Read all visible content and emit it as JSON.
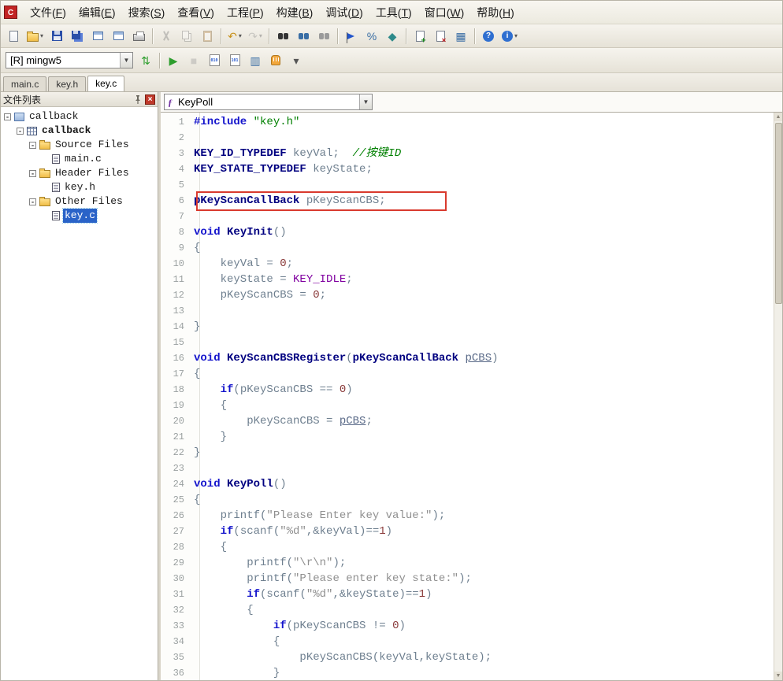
{
  "app": {
    "icon_label": "C"
  },
  "menu_bar": {
    "items": [
      {
        "key": "file",
        "label": "文件(F)"
      },
      {
        "key": "edit",
        "label": "编辑(E)"
      },
      {
        "key": "search",
        "label": "搜索(S)"
      },
      {
        "key": "view",
        "label": "查看(V)"
      },
      {
        "key": "project",
        "label": "工程(P)"
      },
      {
        "key": "build",
        "label": "构建(B)"
      },
      {
        "key": "debug",
        "label": "调试(D)"
      },
      {
        "key": "tools",
        "label": "工具(T)"
      },
      {
        "key": "window",
        "label": "窗口(W)"
      },
      {
        "key": "help",
        "label": "帮助(H)"
      }
    ]
  },
  "toolbar_main": {
    "icons": [
      {
        "name": "new-file",
        "kind": "page"
      },
      {
        "name": "open-file",
        "kind": "folder",
        "dropdown": true
      },
      {
        "name": "save",
        "kind": "floppy"
      },
      {
        "name": "save-all",
        "kind": "floppy2"
      },
      {
        "name": "close-window",
        "kind": "win"
      },
      {
        "name": "close-all-windows",
        "kind": "win"
      },
      {
        "name": "print",
        "kind": "printer"
      },
      {
        "sep": true
      },
      {
        "name": "cut",
        "kind": "cut",
        "disabled": true
      },
      {
        "name": "copy",
        "kind": "pages",
        "disabled": true
      },
      {
        "name": "paste",
        "kind": "clipboard",
        "disabled": true
      },
      {
        "sep": true
      },
      {
        "name": "undo",
        "kind": "glyph",
        "glyph": "↶",
        "color": "#c8921e",
        "dropdown": true
      },
      {
        "name": "redo",
        "kind": "glyph",
        "glyph": "↷",
        "color": "#8a8a8a",
        "disabled": true,
        "dropdown": true
      },
      {
        "sep": true
      },
      {
        "name": "find",
        "kind": "binoc-dark"
      },
      {
        "name": "find-in-files",
        "kind": "binoc-blue"
      },
      {
        "name": "find-replace",
        "kind": "binoc-dim"
      },
      {
        "sep": true
      },
      {
        "name": "toggle-bookmark",
        "kind": "flag"
      },
      {
        "name": "comment",
        "kind": "glyph",
        "glyph": "%",
        "color": "#3a6ea5"
      },
      {
        "name": "goto-line",
        "kind": "glyph",
        "glyph": "◆",
        "color": "#2d8a8a"
      },
      {
        "sep": true
      },
      {
        "name": "add-file",
        "kind": "page-plus"
      },
      {
        "name": "remove-file",
        "kind": "page-x"
      },
      {
        "name": "export",
        "kind": "glyph",
        "glyph": "▦",
        "color": "#3a6ea5"
      },
      {
        "sep": true
      },
      {
        "name": "help",
        "kind": "round",
        "glyph": "?"
      },
      {
        "name": "about",
        "kind": "round",
        "glyph": "i",
        "dropdown": true
      }
    ]
  },
  "toolbar_build": {
    "config_value": "[R] mingw5",
    "icons": [
      {
        "name": "switch-build-target",
        "kind": "glyph",
        "glyph": "⇅",
        "color": "#2e9e2e"
      },
      {
        "sep": true
      },
      {
        "name": "run",
        "kind": "glyph",
        "glyph": "▶",
        "color": "#2e9e2e"
      },
      {
        "name": "stop",
        "kind": "glyph",
        "glyph": "■",
        "color": "#9a9a9a",
        "disabled": true
      },
      {
        "name": "step-over",
        "kind": "step",
        "glyph": "010"
      },
      {
        "name": "step-into",
        "kind": "step",
        "glyph": "101"
      },
      {
        "name": "build-file",
        "kind": "glyph",
        "glyph": "▥",
        "color": "#3a6ea5"
      },
      {
        "name": "pause",
        "kind": "hand"
      },
      {
        "name": "more-build-actions",
        "kind": "glyph",
        "glyph": "▾",
        "color": "#555555"
      }
    ]
  },
  "doc_tabs": {
    "active": "key.c",
    "items": [
      "main.c",
      "key.h",
      "key.c"
    ]
  },
  "sidebar": {
    "title": "文件列表",
    "tree": [
      {
        "depth": 0,
        "label": "callback",
        "icon": "workspace",
        "expand": true
      },
      {
        "depth": 1,
        "label": "callback",
        "icon": "project",
        "expand": true,
        "bold": true
      },
      {
        "depth": 2,
        "label": "Source Files",
        "icon": "folder",
        "expand": true
      },
      {
        "depth": 3,
        "label": "main.c",
        "icon": "doc"
      },
      {
        "depth": 2,
        "label": "Header Files",
        "icon": "folder",
        "expand": true
      },
      {
        "depth": 3,
        "label": "key.h",
        "icon": "doc"
      },
      {
        "depth": 2,
        "label": "Other Files",
        "icon": "folder",
        "expand": true
      },
      {
        "depth": 3,
        "label": "key.c",
        "icon": "doc",
        "selected": true
      }
    ]
  },
  "editor": {
    "function_selector": "KeyPoll",
    "highlight_line": 6,
    "lines": [
      [
        [
          "k",
          "#include"
        ],
        [
          "p",
          " "
        ],
        [
          "g",
          "\"key.h\""
        ]
      ],
      [],
      [
        [
          "t",
          "KEY_ID_TYPEDEF"
        ],
        [
          "p",
          " keyVal;  "
        ],
        [
          "c",
          "//按键ID"
        ]
      ],
      [
        [
          "t",
          "KEY_STATE_TYPEDEF"
        ],
        [
          "p",
          " keyState;"
        ]
      ],
      [],
      [
        [
          "t",
          "pKeyScanCallBack"
        ],
        [
          "p",
          " pKeyScanCBS;"
        ]
      ],
      [],
      [
        [
          "k",
          "void"
        ],
        [
          "p",
          " "
        ],
        [
          "t",
          "KeyInit"
        ],
        [
          "p",
          "()"
        ]
      ],
      [
        [
          "p",
          "{"
        ]
      ],
      [
        [
          "p",
          "    keyVal = "
        ],
        [
          "n",
          "0"
        ],
        [
          "p",
          ";"
        ]
      ],
      [
        [
          "p",
          "    keyState = "
        ],
        [
          "m",
          "KEY_IDLE"
        ],
        [
          "p",
          ";"
        ]
      ],
      [
        [
          "p",
          "    pKeyScanCBS = "
        ],
        [
          "n",
          "0"
        ],
        [
          "p",
          ";"
        ]
      ],
      [],
      [
        [
          "p",
          "}"
        ]
      ],
      [],
      [
        [
          "k",
          "void"
        ],
        [
          "p",
          " "
        ],
        [
          "t",
          "KeyScanCBSRegister"
        ],
        [
          "p",
          "("
        ],
        [
          "t",
          "pKeyScanCallBack"
        ],
        [
          "p",
          " "
        ],
        [
          "u",
          "pCBS"
        ],
        [
          "p",
          ")"
        ]
      ],
      [
        [
          "p",
          "{"
        ]
      ],
      [
        [
          "p",
          "    "
        ],
        [
          "k",
          "if"
        ],
        [
          "p",
          "(pKeyScanCBS == "
        ],
        [
          "n",
          "0"
        ],
        [
          "p",
          ")"
        ]
      ],
      [
        [
          "p",
          "    {"
        ]
      ],
      [
        [
          "p",
          "        pKeyScanCBS = "
        ],
        [
          "u",
          "pCBS"
        ],
        [
          "p",
          ";"
        ]
      ],
      [
        [
          "p",
          "    }"
        ]
      ],
      [
        [
          "p",
          "}"
        ]
      ],
      [],
      [
        [
          "k",
          "void"
        ],
        [
          "p",
          " "
        ],
        [
          "t",
          "KeyPoll"
        ],
        [
          "p",
          "()"
        ]
      ],
      [
        [
          "p",
          "{"
        ]
      ],
      [
        [
          "p",
          "    printf("
        ],
        [
          "s",
          "\"Please Enter key value:\""
        ],
        [
          "p",
          ");"
        ]
      ],
      [
        [
          "p",
          "    "
        ],
        [
          "k",
          "if"
        ],
        [
          "p",
          "(scanf("
        ],
        [
          "s",
          "\"%d\""
        ],
        [
          "p",
          ",&keyVal)=="
        ],
        [
          "n",
          "1"
        ],
        [
          "p",
          ")"
        ]
      ],
      [
        [
          "p",
          "    {"
        ]
      ],
      [
        [
          "p",
          "        printf("
        ],
        [
          "s",
          "\"\\r\\n\""
        ],
        [
          "p",
          ");"
        ]
      ],
      [
        [
          "p",
          "        printf("
        ],
        [
          "s",
          "\"Please enter key state:\""
        ],
        [
          "p",
          ");"
        ]
      ],
      [
        [
          "p",
          "        "
        ],
        [
          "k",
          "if"
        ],
        [
          "p",
          "(scanf("
        ],
        [
          "s",
          "\"%d\""
        ],
        [
          "p",
          ",&keyState)=="
        ],
        [
          "n",
          "1"
        ],
        [
          "p",
          ")"
        ]
      ],
      [
        [
          "p",
          "        {"
        ]
      ],
      [
        [
          "p",
          "            "
        ],
        [
          "k",
          "if"
        ],
        [
          "p",
          "(pKeyScanCBS != "
        ],
        [
          "n",
          "0"
        ],
        [
          "p",
          ")"
        ]
      ],
      [
        [
          "p",
          "            {"
        ]
      ],
      [
        [
          "p",
          "                pKeyScanCBS(keyVal,keyState);"
        ]
      ],
      [
        [
          "p",
          "            }"
        ]
      ]
    ]
  }
}
